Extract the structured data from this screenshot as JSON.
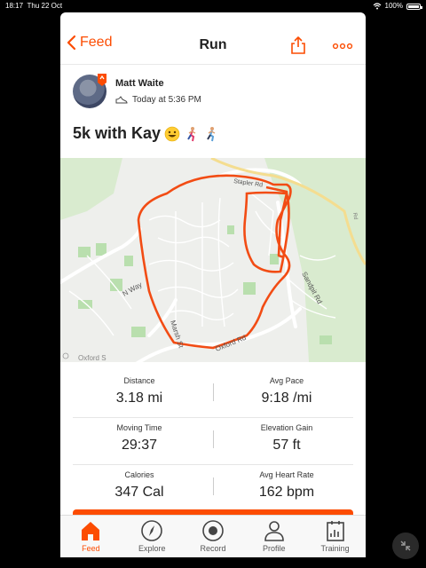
{
  "status_bar": {
    "time": "18:17",
    "date": "Thu 22 Oct",
    "battery": "100%"
  },
  "nav": {
    "back_label": "Feed",
    "title": "Run"
  },
  "athlete": {
    "name": "Matt Waite",
    "time": "Today at 5:36 PM"
  },
  "activity": {
    "title": "5k with Kay"
  },
  "map": {
    "labels": {
      "top_road": "Stapler Rd",
      "n_way": "N Way",
      "oxford_rd": "Oxford Rd",
      "sandpit_rd": "Sandpit Rd",
      "street": "Marsh St",
      "bottom_left": "Oxford S",
      "right_edge": "Rd"
    }
  },
  "stats": [
    {
      "left": {
        "label": "Distance",
        "value": "3.18 mi"
      },
      "right": {
        "label": "Avg Pace",
        "value": "9:18 /mi"
      }
    },
    {
      "left": {
        "label": "Moving Time",
        "value": "29:37"
      },
      "right": {
        "label": "Elevation Gain",
        "value": "57 ft"
      }
    },
    {
      "left": {
        "label": "Calories",
        "value": "347 Cal"
      },
      "right": {
        "label": "Avg Heart Rate",
        "value": "162 bpm"
      }
    }
  ],
  "tabs": [
    {
      "label": "Feed",
      "icon": "home-icon"
    },
    {
      "label": "Explore",
      "icon": "compass-icon"
    },
    {
      "label": "Record",
      "icon": "record-icon"
    },
    {
      "label": "Profile",
      "icon": "profile-icon"
    },
    {
      "label": "Training",
      "icon": "training-icon"
    }
  ],
  "colors": {
    "accent": "#fc4c02",
    "route": "#f24c14"
  }
}
